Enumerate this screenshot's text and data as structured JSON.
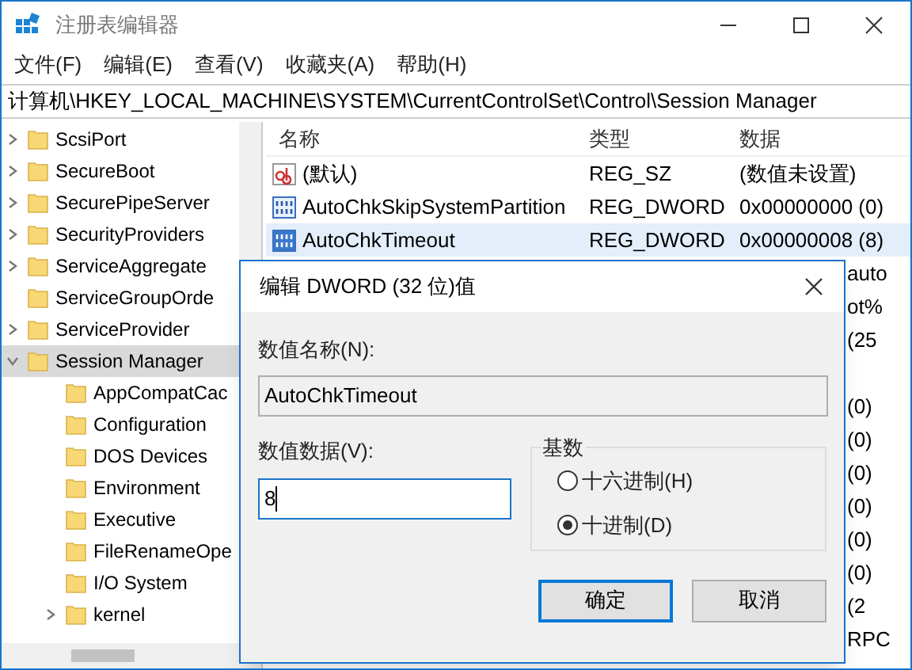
{
  "window": {
    "title": "注册表编辑器"
  },
  "menu": [
    "文件(F)",
    "编辑(E)",
    "查看(V)",
    "收藏夹(A)",
    "帮助(H)"
  ],
  "address": "计算机\\HKEY_LOCAL_MACHINE\\SYSTEM\\CurrentControlSet\\Control\\Session Manager",
  "tree": [
    {
      "label": "ScsiPort",
      "expandable": true,
      "expanded": false,
      "selected": false
    },
    {
      "label": "SecureBoot",
      "expandable": true,
      "expanded": false,
      "selected": false
    },
    {
      "label": "SecurePipeServer",
      "expandable": true,
      "expanded": false,
      "selected": false
    },
    {
      "label": "SecurityProviders",
      "expandable": true,
      "expanded": false,
      "selected": false
    },
    {
      "label": "ServiceAggregate",
      "expandable": true,
      "expanded": false,
      "selected": false
    },
    {
      "label": "ServiceGroupOrde",
      "expandable": false,
      "selected": false
    },
    {
      "label": "ServiceProvider",
      "expandable": true,
      "expanded": false,
      "selected": false
    },
    {
      "label": "Session Manager",
      "expandable": true,
      "expanded": true,
      "selected": true,
      "children": [
        {
          "label": "AppCompatCac",
          "expandable": false,
          "selected": false
        },
        {
          "label": "Configuration",
          "expandable": false,
          "selected": false
        },
        {
          "label": "DOS Devices",
          "expandable": false,
          "selected": false
        },
        {
          "label": "Environment",
          "expandable": false,
          "selected": false
        },
        {
          "label": "Executive",
          "expandable": false,
          "selected": false
        },
        {
          "label": "FileRenameOpe",
          "expandable": false,
          "selected": false
        },
        {
          "label": "I/O System",
          "expandable": false,
          "selected": false
        },
        {
          "label": "kernel",
          "expandable": true,
          "expanded": false,
          "selected": false
        }
      ]
    }
  ],
  "table": {
    "columns": [
      "名称",
      "类型",
      "数据"
    ],
    "rows": [
      {
        "kind": "string",
        "name": "(默认)",
        "type": "REG_SZ",
        "data": "(数值未设置)",
        "selected": false
      },
      {
        "kind": "binary",
        "name": "AutoChkSkipSystemPartition",
        "type": "REG_DWORD",
        "data": "0x00000000 (0)",
        "selected": false
      },
      {
        "kind": "binary",
        "name": "AutoChkTimeout",
        "type": "REG_DWORD",
        "data": "0x00000008 (8)",
        "selected": true
      }
    ],
    "hidden_row_fragments": [
      "auto",
      "ot%",
      "(25",
      "(0)",
      "(0)",
      "(0)",
      "(0)",
      "(0)",
      "(0)",
      "(2",
      "RPC"
    ]
  },
  "dialog": {
    "title": "编辑 DWORD (32 位)值",
    "name_label": "数值名称(N):",
    "name_value": "AutoChkTimeout",
    "data_label": "数值数据(V):",
    "data_value": "8",
    "base_group": "基数",
    "bases": [
      {
        "label": "十六进制(H)",
        "selected": false
      },
      {
        "label": "十进制(D)",
        "selected": true
      }
    ],
    "buttons": [
      {
        "label": "确定",
        "default": true
      },
      {
        "label": "取消",
        "default": false
      }
    ]
  }
}
